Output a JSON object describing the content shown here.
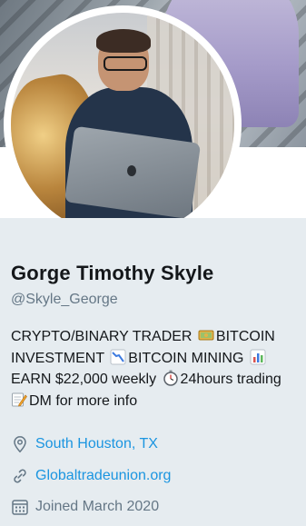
{
  "profile": {
    "name": "Gorge Timothy Skyle",
    "handle": "@Skyle_George",
    "bio_line1": "CRYPTO/BINARY TRADER",
    "bio_line1b": "BITCOIN",
    "bio_line2": "INVESTMENT",
    "bio_line2b": "BITCOIN MINING",
    "bio_line3": "EARN $22,000 weekly",
    "bio_line3b": "24hours trading",
    "bio_line4": "DM for more info",
    "location": "South Houston, TX",
    "website": "Globaltradeunion.org",
    "joined": "Joined March 2020"
  },
  "icons": {
    "location": "location-pin-icon",
    "website": "link-icon",
    "joined": "calendar-icon",
    "emoji_money": "money-banknote-emoji",
    "emoji_chart_down": "chart-decreasing-emoji",
    "emoji_bar_chart": "bar-chart-emoji",
    "emoji_clock": "stopwatch-emoji",
    "emoji_memo": "memo-emoji"
  },
  "colors": {
    "background": "#e6ecf0",
    "text": "#14171a",
    "muted": "#657786",
    "link": "#1b95e0"
  }
}
